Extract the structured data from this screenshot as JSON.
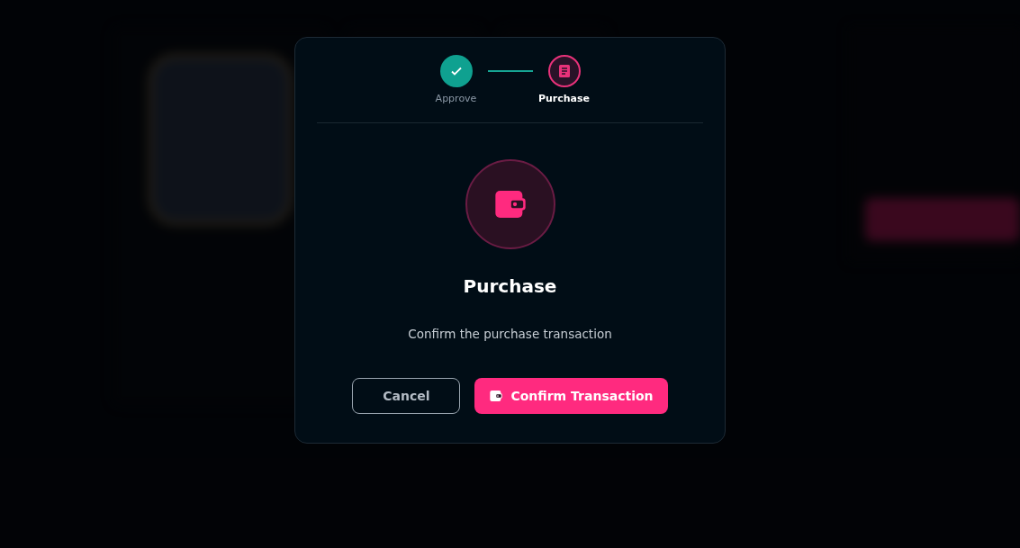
{
  "steps": [
    {
      "label": "Approve",
      "completed": true,
      "selected": false
    },
    {
      "label": "Purchase",
      "completed": false,
      "selected": true
    }
  ],
  "dialog": {
    "title": "Purchase",
    "message": "Confirm the purchase transaction"
  },
  "buttons": [
    {
      "label": "Cancel",
      "kind": "secondary"
    },
    {
      "label": "Confirm Transaction",
      "kind": "primary"
    }
  ]
}
